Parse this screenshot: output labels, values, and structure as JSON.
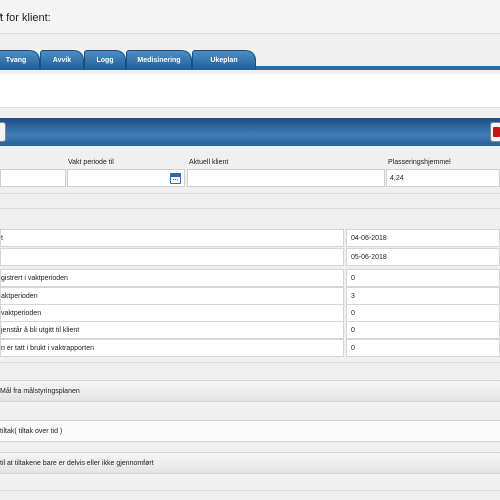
{
  "header": {
    "title": "t for klient:"
  },
  "tabs": [
    {
      "label": "Tvang"
    },
    {
      "label": "Avvik"
    },
    {
      "label": "Logg"
    },
    {
      "label": "Medisinering"
    },
    {
      "label": "Ukeplan"
    }
  ],
  "subrow": {
    "text": "t"
  },
  "fields": {
    "vakt_periode_til_label": "Vakt periode til",
    "aktuell_klient_label": "Aktuell klient",
    "plasseringshjemmel_label": "Plasseringshjemmel",
    "plasseringshjemmel_value": "4,24"
  },
  "rows": [
    {
      "label": "t",
      "value": "04-06-2018"
    },
    {
      "label": "",
      "value": "05-06-2018"
    },
    {
      "label": "gistrert i vaktperioden",
      "value": "0"
    },
    {
      "label": "aktperioden",
      "value": "3"
    },
    {
      "label": "vaktperioden",
      "value": "0"
    },
    {
      "label": "jenstår å bli utgitt til klient",
      "value": "0"
    },
    {
      "label": "n er tatt i brukt i vaktrapporten",
      "value": "0"
    }
  ],
  "sections": [
    {
      "label": "Mål fra målstyringsplanen"
    },
    {
      "label": "tiltak( tiltak over tid )"
    },
    {
      "label": "til at tiltakene bare er delvis eller ikke gjennomført"
    }
  ],
  "colors": {
    "tab": "#2d6aa0",
    "banner": "#2a5f96",
    "delete_icon": "#cc1111",
    "calendar_icon": "#2b6cb0"
  },
  "icons": {
    "calendar": "calendar-icon",
    "delete": "delete-icon"
  }
}
